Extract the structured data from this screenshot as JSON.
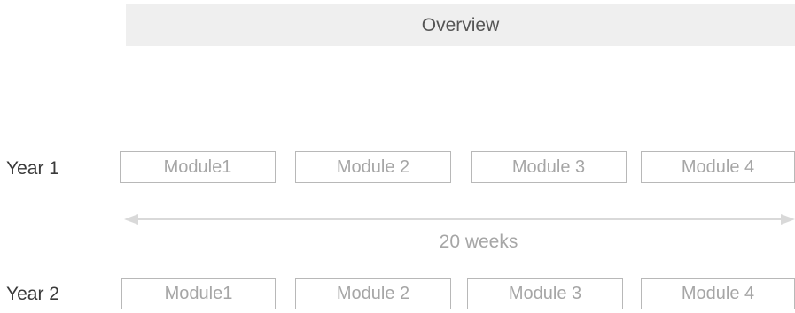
{
  "header": {
    "title": "Overview"
  },
  "timeline": {
    "duration_label": "20 weeks"
  },
  "years": [
    {
      "label": "Year 1",
      "modules": [
        "Module1",
        "Module 2",
        "Module 3",
        "Module 4"
      ]
    },
    {
      "label": "Year 2",
      "modules": [
        "Module1",
        "Module 2",
        "Module 3",
        "Module 4"
      ]
    }
  ],
  "colors": {
    "header_bg": "#efefef",
    "module_border": "#b8b8b8",
    "muted_text": "#a6a6a6",
    "arrow": "#d9d9d9"
  }
}
